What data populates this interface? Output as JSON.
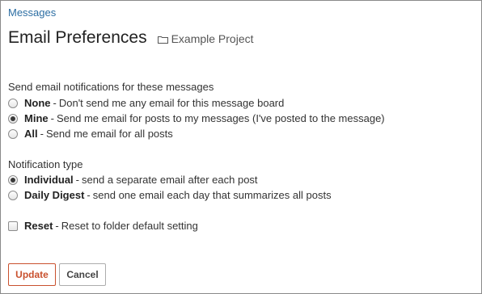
{
  "breadcrumb": "Messages",
  "page_title": "Email Preferences",
  "project": {
    "icon": "folder-icon",
    "name": "Example Project"
  },
  "notifications": {
    "label": "Send email notifications for these messages",
    "options": [
      {
        "name": "None",
        "sep": "-",
        "desc": "Don't send me any email for this message board",
        "checked": false
      },
      {
        "name": "Mine",
        "sep": "-",
        "desc": "Send me email for posts to my messages (I've posted to the message)",
        "checked": true
      },
      {
        "name": "All",
        "sep": "-",
        "desc": "Send me email for all posts",
        "checked": false
      }
    ]
  },
  "notification_type": {
    "label": "Notification type",
    "options": [
      {
        "name": "Individual",
        "sep": "-",
        "desc": "send a separate email after each post",
        "checked": true
      },
      {
        "name": "Daily Digest",
        "sep": "-",
        "desc": "send one email each day that summarizes all posts",
        "checked": false
      }
    ]
  },
  "reset": {
    "name": "Reset",
    "sep": "-",
    "desc": "Reset to folder default setting",
    "checked": false
  },
  "buttons": {
    "update": "Update",
    "cancel": "Cancel"
  },
  "colors": {
    "link": "#2c6ea3",
    "accent": "#c9512e"
  }
}
